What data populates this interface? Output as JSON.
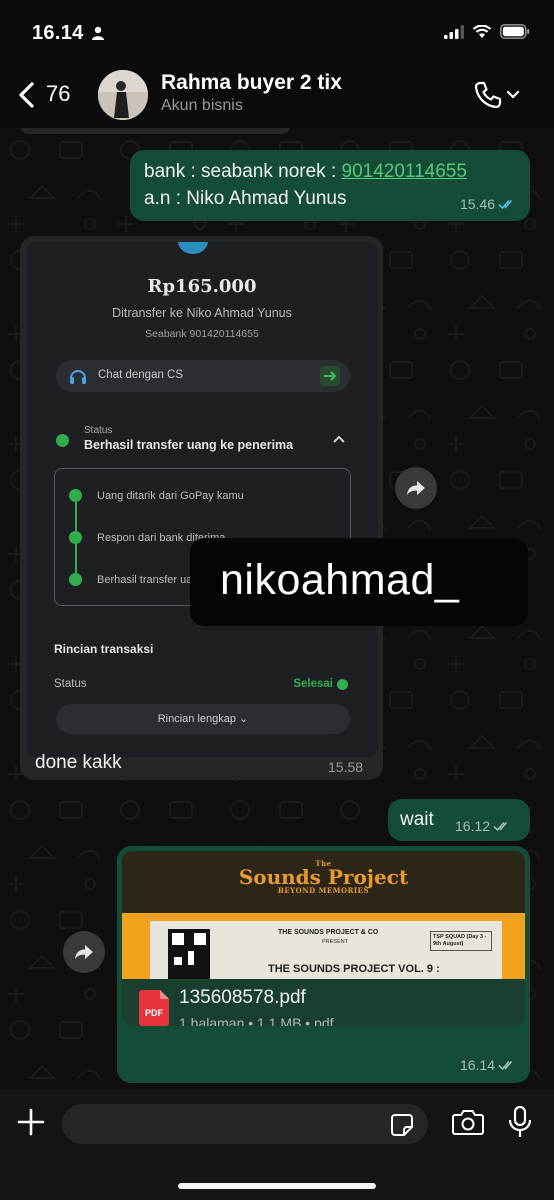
{
  "status_bar": {
    "time": "16.14"
  },
  "header": {
    "back_count": "76",
    "contact_name": "Rahma buyer 2 tix",
    "contact_subtitle": "Akun bisnis",
    "icons": [
      "chevron-left-icon",
      "phone-icon",
      "chevron-down-icon"
    ]
  },
  "messages": {
    "bank": {
      "line1_prefix": "bank : seabank norek : ",
      "account_link": "901420114655",
      "line2": "a.n : Niko Ahmad Yunus",
      "time": "15.46",
      "status": "read"
    },
    "screenshot": {
      "amount": "Rp165.000",
      "transferred_to": "Ditransfer ke Niko Ahmad Yunus",
      "account": "Seabank 901420114655",
      "chat_cs": "Chat dengan CS",
      "status_label": "Status",
      "status_value": "Berhasil transfer uang ke penerima",
      "steps": [
        "Uang ditarik dari GoPay kamu",
        "Respon dari bank diterima",
        "Berhasil transfer ua"
      ],
      "rincian_title": "Rincian transaksi",
      "rincian_status_label": "Status",
      "rincian_status_value": "Selesai",
      "rincian_button": "Rincian lengkap",
      "sticker_text": "nikoahmad_"
    },
    "done": {
      "text": "done kakk",
      "time": "15.58"
    },
    "wait": {
      "text": "wait",
      "time": "16.12",
      "status": "delivered"
    },
    "document": {
      "preview_title_top": "The",
      "preview_title_main": "Sounds Project",
      "preview_subtitle": "BEYOND MEMORIES",
      "ticket_org": "THE SOUNDS PROJECT & CO",
      "ticket_present": "PRESENT",
      "ticket_event": "THE SOUNDS PROJECT VOL. 9 :",
      "ticket_badge": "TSP SQUAD (Day 3 - 9th August)",
      "file_icon_label": "PDF",
      "file_name": "135608578.pdf",
      "file_info": "1 halaman • 1,1 MB • pdf",
      "time": "16.14",
      "status": "delivered"
    }
  },
  "colors": {
    "outgoing_bubble": "#134d37",
    "incoming_bubble": "#262626",
    "link": "#57c87b",
    "success_green": "#2fae4b",
    "read_tick": "#53bdeb"
  }
}
